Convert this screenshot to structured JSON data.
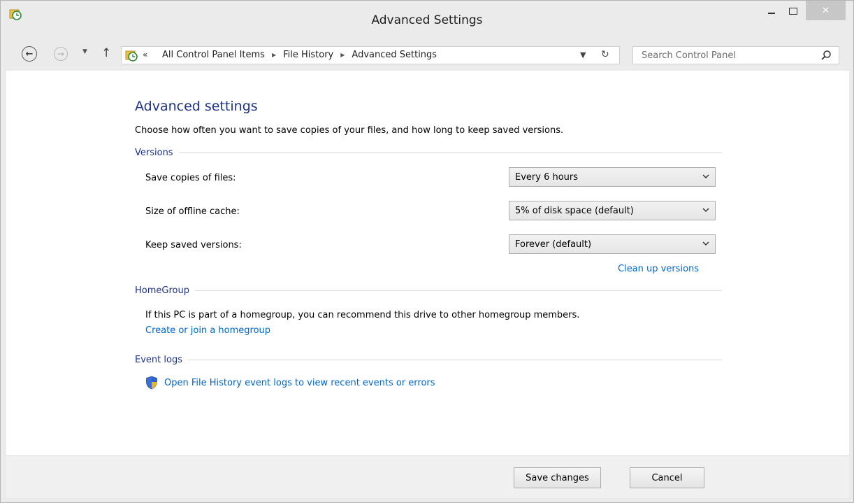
{
  "window": {
    "title": "Advanced Settings",
    "close_glyph": "✕"
  },
  "navigation": {
    "back_icon": "back-arrow-icon",
    "forward_icon": "forward-arrow-icon",
    "address_prefix": "«",
    "breadcrumbs": [
      "All Control Panel Items",
      "File History",
      "Advanced Settings"
    ],
    "search_placeholder": "Search Control Panel"
  },
  "main": {
    "heading": "Advanced settings",
    "intro": "Choose how often you want to save copies of your files, and how long to keep saved versions.",
    "versions": {
      "title": "Versions",
      "rows": [
        {
          "label": "Save copies of files:",
          "value": "Every 6 hours"
        },
        {
          "label": "Size of offline cache:",
          "value": "5% of disk space (default)"
        },
        {
          "label": "Keep saved versions:",
          "value": "Forever (default)"
        }
      ],
      "cleanup_link": "Clean up versions"
    },
    "homegroup": {
      "title": "HomeGroup",
      "text": "If this PC is part of a homegroup, you can recommend this drive to other homegroup members.",
      "link": "Create or join a homegroup"
    },
    "event_logs": {
      "title": "Event logs",
      "link": "Open File History event logs to view recent events or errors"
    }
  },
  "footer": {
    "save_label": "Save changes",
    "cancel_label": "Cancel"
  },
  "colors": {
    "heading": "#1e3287",
    "link": "#0066cc",
    "background": "#ebebeb"
  }
}
